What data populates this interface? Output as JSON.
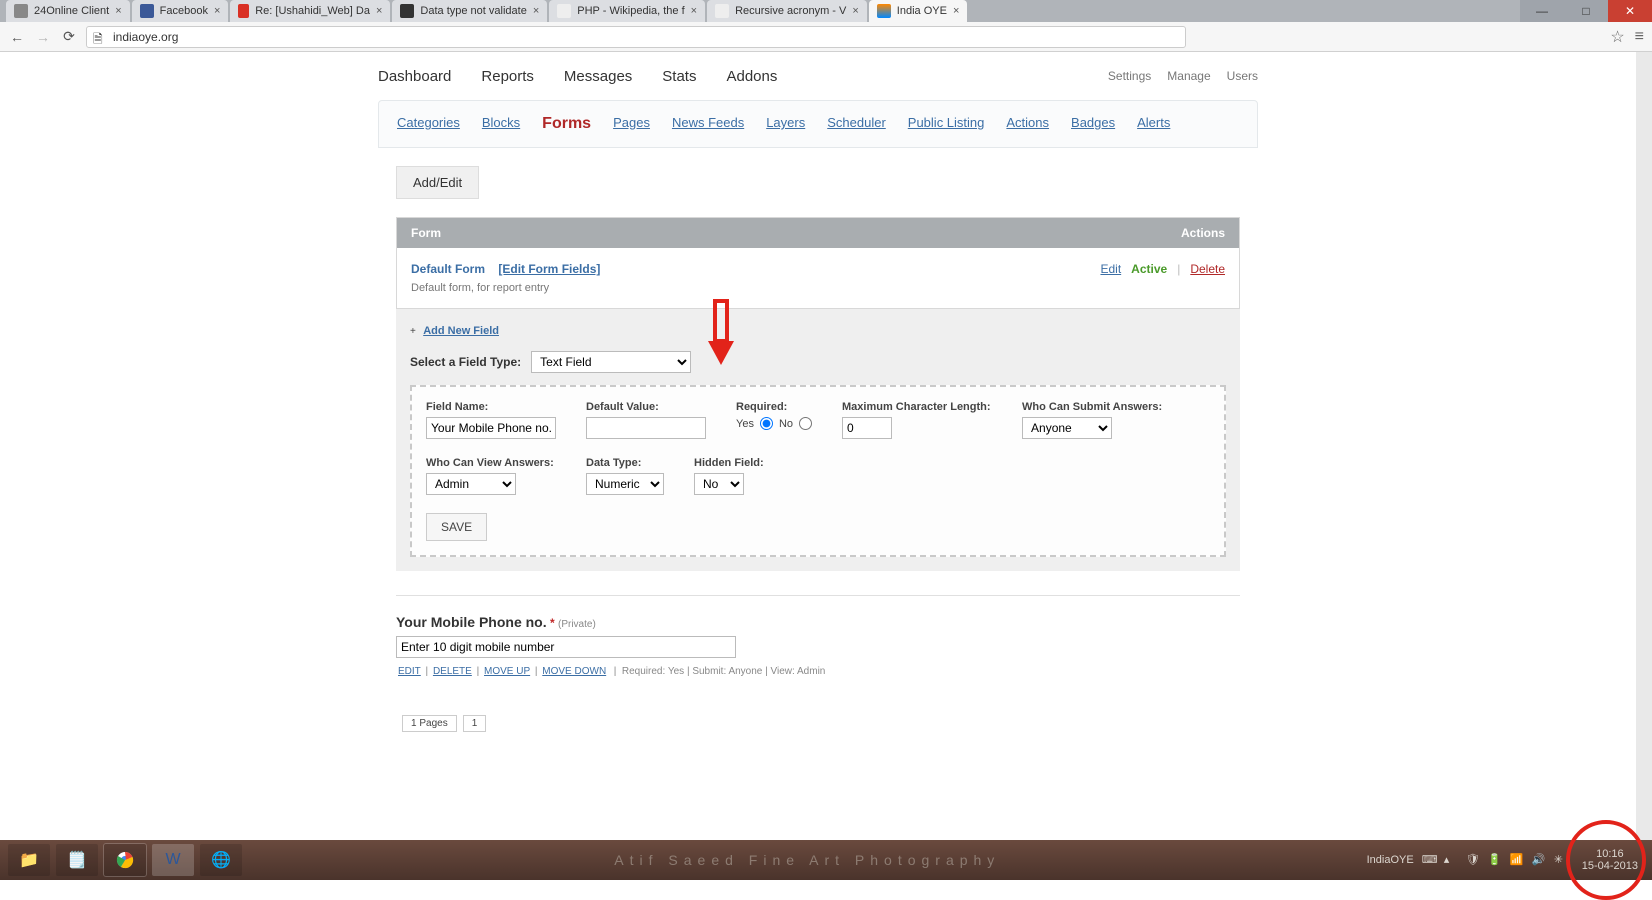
{
  "browser": {
    "tabs": [
      {
        "label": "24Online Client"
      },
      {
        "label": "Facebook"
      },
      {
        "label": "Re: [Ushahidi_Web] Da"
      },
      {
        "label": "Data type not validate"
      },
      {
        "label": "PHP - Wikipedia, the f"
      },
      {
        "label": "Recursive acronym - V"
      },
      {
        "label": "India OYE",
        "active": true
      }
    ],
    "url": "indiaoye.org"
  },
  "nav": {
    "main": [
      "Dashboard",
      "Reports",
      "Messages",
      "Stats",
      "Addons"
    ],
    "admin": [
      "Settings",
      "Manage",
      "Users"
    ]
  },
  "sub_tabs": {
    "items": [
      "Categories",
      "Blocks",
      "Forms",
      "Pages",
      "News Feeds",
      "Layers",
      "Scheduler",
      "Public Listing",
      "Actions",
      "Badges",
      "Alerts"
    ],
    "active": "Forms"
  },
  "buttons": {
    "add_edit": "Add/Edit",
    "save": "SAVE"
  },
  "form_table": {
    "hdr_form": "Form",
    "hdr_actions": "Actions",
    "name": "Default Form",
    "edit_fields": "[Edit Form Fields]",
    "desc": "Default form, for report entry",
    "edit": "Edit",
    "active": "Active",
    "delete": "Delete"
  },
  "editor": {
    "add_field": "Add New Field",
    "select_label": "Select a Field Type:",
    "field_type": "Text Field",
    "labels": {
      "field_name": "Field Name:",
      "default_value": "Default Value:",
      "required": "Required:",
      "yes": "Yes",
      "no": "No",
      "max_len": "Maximum Character Length:",
      "who_submit": "Who Can Submit Answers:",
      "who_view": "Who Can View Answers:",
      "data_type": "Data Type:",
      "hidden": "Hidden Field:"
    },
    "values": {
      "field_name": "Your Mobile Phone no.",
      "default_value": "",
      "max_len": "0",
      "who_submit": "Anyone",
      "who_view": "Admin",
      "data_type": "Numeric",
      "hidden": "No"
    }
  },
  "preview": {
    "title": "Your Mobile Phone no.",
    "private": "(Private)",
    "placeholder": "Enter 10 digit mobile number",
    "links": {
      "edit": "EDIT",
      "delete": "DELETE",
      "move_up": "MOVE UP",
      "move_down": "MOVE DOWN"
    },
    "meta": "Required: Yes   |   Submit: Anyone   |   View: Admin"
  },
  "pager": {
    "pages": "1 Pages",
    "one": "1"
  },
  "taskbar": {
    "caption": "Atif Saeed Fine Art Photography",
    "app": "IndiaOYE",
    "time": "10:16",
    "date": "15-04-2013"
  }
}
